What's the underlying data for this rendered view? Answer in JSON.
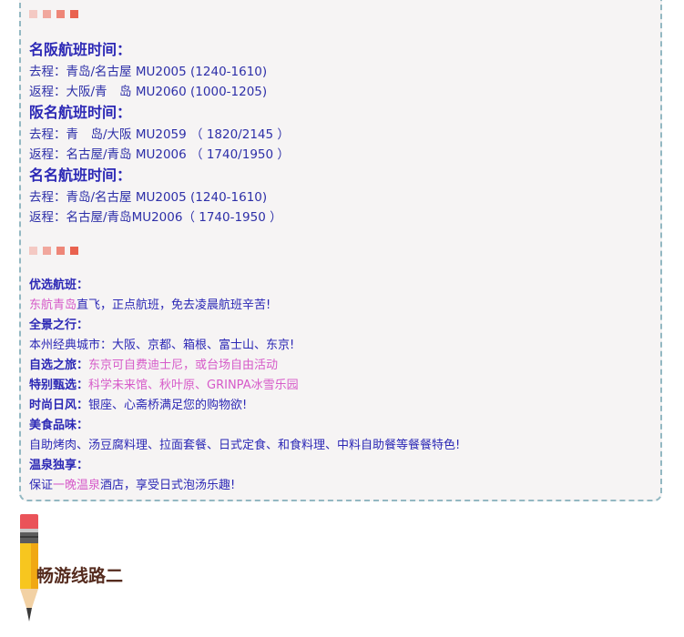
{
  "flights": {
    "group1": {
      "title": "名阪航班时间：",
      "outbound": {
        "label": "去程：",
        "route": "青岛/名古屋",
        "flight": " MU2005 (1240-1610)"
      },
      "return": {
        "label": "返程：",
        "route": "大阪/青　岛",
        "flight": " MU2060 (1000-1205)"
      }
    },
    "group2": {
      "title": "阪名航班时间：",
      "outbound": {
        "label": "去程：",
        "route": "青　岛/大阪",
        "flight": " MU2059 （ 1820/2145 ）"
      },
      "return": {
        "label": "返程：",
        "route": "名古屋/青岛",
        "flight": " MU2006 （ 1740/1950 ）"
      }
    },
    "group3": {
      "title": "名名航班时间：",
      "outbound": {
        "label": "去程：",
        "route": "青岛/名古屋",
        "flight": " MU2005 (1240-1610)"
      },
      "return": {
        "label": "返程：",
        "route": "名古屋/青岛",
        "flight": "MU2006（ 1740-1950 ）"
      }
    }
  },
  "highlights": {
    "preferred_label": "优选航班：",
    "preferred_pink": "东航青岛",
    "preferred_rest": "直飞，正点航班，免去凌晨航班辛苦!",
    "panorama_label": "全景之行：",
    "panorama_text": "本州经典城市：大阪、京都、箱根、富士山、东京!",
    "optional_label": "自选之旅：",
    "optional_text": "东京可自费迪士尼，或台场自由活动",
    "special_label": "特别甄选：",
    "special_text": "科学未来馆、秋叶原、GRINPA冰雪乐园",
    "fashion_label": "时尚日风：",
    "fashion_text": "银座、心斋桥满足您的购物欲!",
    "food_label": "美食品味：",
    "food_text": "自助烤肉、汤豆腐料理、拉面套餐、日式定食、和食料理、中料自助餐等餐餐特色!",
    "onsen_label": "温泉独享：",
    "onsen_prefix": "保证",
    "onsen_pink": "一晚温泉",
    "onsen_rest": "酒店，享受日式泡汤乐趣!"
  },
  "section": {
    "title": "畅游线路二"
  },
  "colors": {
    "text_blue": "#2b27b5",
    "pink": "#d65ac9",
    "card_border": "#93b8c2",
    "title_brown": "#552b1e"
  }
}
